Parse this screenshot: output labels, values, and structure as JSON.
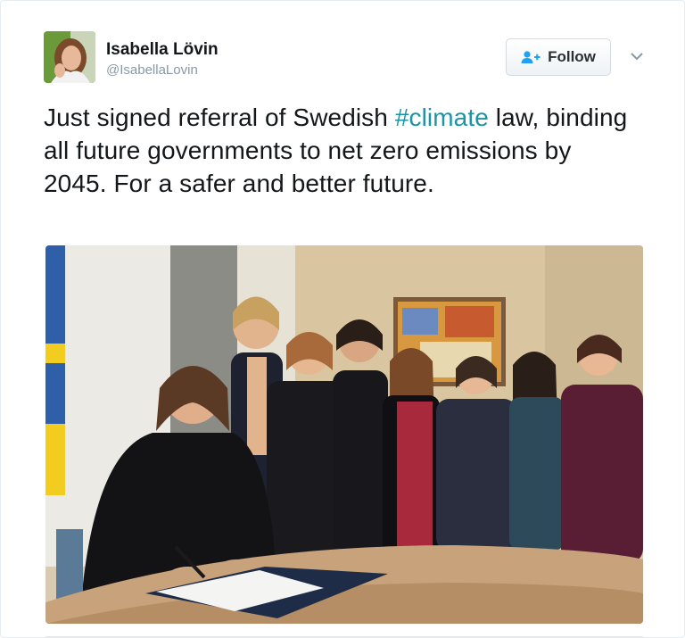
{
  "user": {
    "name": "Isabella Lövin",
    "handle": "@IsabellaLovin"
  },
  "follow_button": {
    "label": "Follow"
  },
  "tweet": {
    "text_before": "Just signed referral of Swedish ",
    "hashtag": "#climate",
    "text_after": " law, binding all future governments to net zero emissions by 2045. For a safer and better future."
  },
  "colors": {
    "hashtag": "#1b95a6",
    "follow_icon": "#1da1f2",
    "handle": "#8899a6"
  },
  "icons": [
    "follow-person-plus-icon",
    "chevron-down-icon"
  ]
}
